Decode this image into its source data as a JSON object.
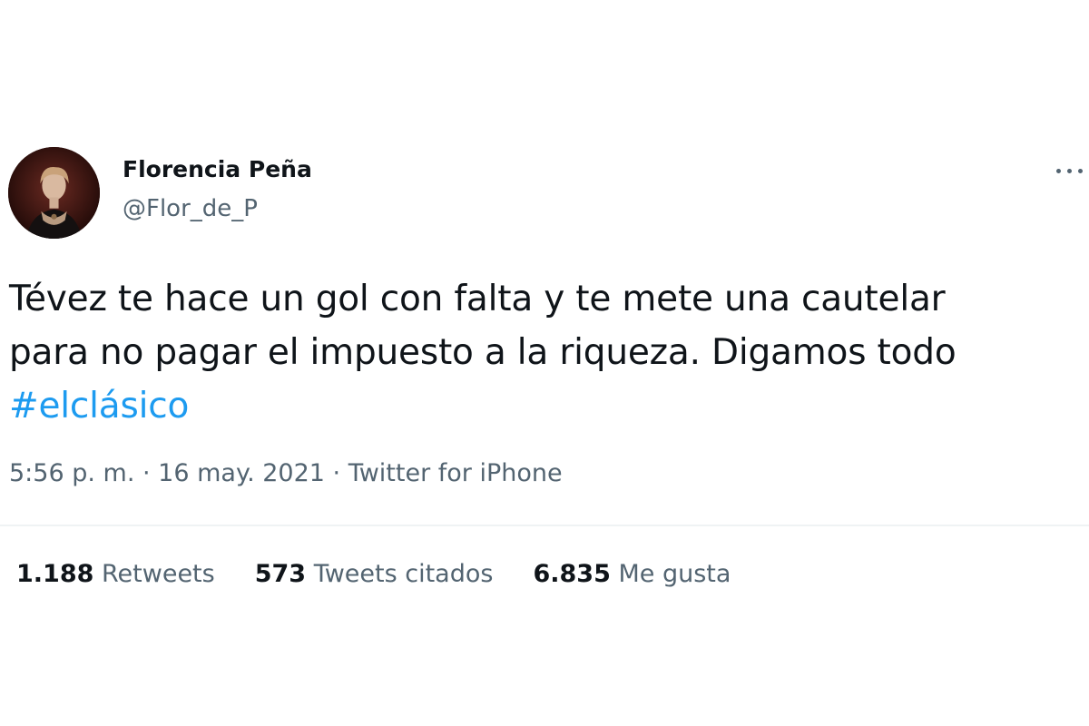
{
  "author": {
    "display_name": "Florencia Peña",
    "handle": "@Flor_de_P"
  },
  "tweet": {
    "line1": "Tévez te hace un gol con falta y te mete una cautelar",
    "line2": "para no pagar el impuesto a la riqueza. Digamos todo",
    "hashtag": "#elclásico"
  },
  "meta": {
    "time": "5:56 p. m.",
    "separator1": " · ",
    "date": "16 may. 2021",
    "separator2": " · ",
    "source": "Twitter for iPhone"
  },
  "stats": [
    {
      "count": "1.188",
      "label": "Retweets"
    },
    {
      "count": "573",
      "label": "Tweets citados"
    },
    {
      "count": "6.835",
      "label": "Me gusta"
    }
  ],
  "icons": {
    "more": "more-options-icon"
  },
  "colors": {
    "text": "#0f1419",
    "secondary": "#536471",
    "link": "#1d9bf0",
    "divider": "#eff3f4"
  }
}
